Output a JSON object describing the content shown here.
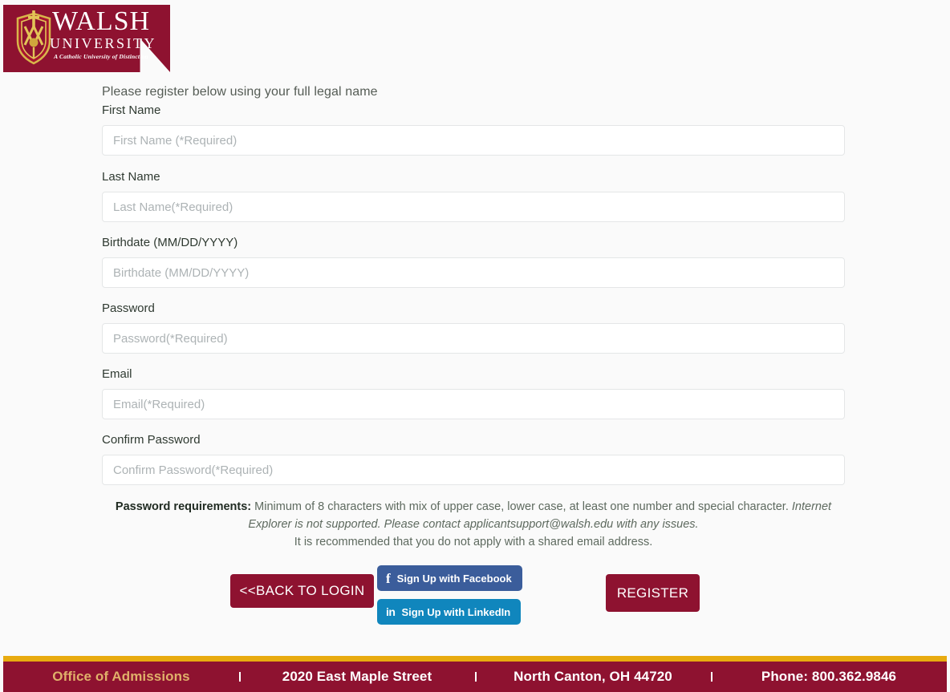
{
  "header": {
    "logo": {
      "brand": "WALSH",
      "subtitle": "UNIVERSITY",
      "tagline": "A Catholic University of Distinction",
      "crest_icon": "shield-crest-icon"
    },
    "colors": {
      "maroon": "#8e1230",
      "gold": "#e8ab10"
    }
  },
  "form": {
    "intro": "Please register below using your full legal name",
    "fields": [
      {
        "label": "First Name",
        "placeholder": "First Name (*Required)",
        "type": "text",
        "name": "first-name"
      },
      {
        "label": "Last Name",
        "placeholder": "Last Name(*Required)",
        "type": "text",
        "name": "last-name"
      },
      {
        "label": "Birthdate (MM/DD/YYYY)",
        "placeholder": "Birthdate (MM/DD/YYYY)",
        "type": "text",
        "name": "birthdate"
      },
      {
        "label": "Password",
        "placeholder": "Password(*Required)",
        "type": "password",
        "name": "password"
      },
      {
        "label": "Email",
        "placeholder": "Email(*Required)",
        "type": "text",
        "name": "email"
      },
      {
        "label": "Confirm Password",
        "placeholder": "Confirm Password(*Required)",
        "type": "password",
        "name": "confirm-password"
      }
    ],
    "note": {
      "heading": "Password requirements:",
      "line1": " Minimum of 8 characters with mix of upper case, lower case, at least one number and special character. ",
      "line1_italic": "Internet Explorer is not supported. Please contact applicantsupport@walsh.edu with any issues.",
      "line2": "It is recommended that you do not apply with a shared email address."
    }
  },
  "buttons": {
    "back_to_login": "<<BACK TO LOGIN",
    "register": "REGISTER",
    "facebook": "Sign Up with Facebook",
    "facebook_glyph": "f",
    "linkedin": "Sign Up with LinkedIn",
    "linkedin_glyph": "in"
  },
  "footer": {
    "cells": [
      "Office of Admissions",
      "2020 East Maple Street",
      "North Canton, OH 44720",
      "Phone: 800.362.9846"
    ]
  }
}
